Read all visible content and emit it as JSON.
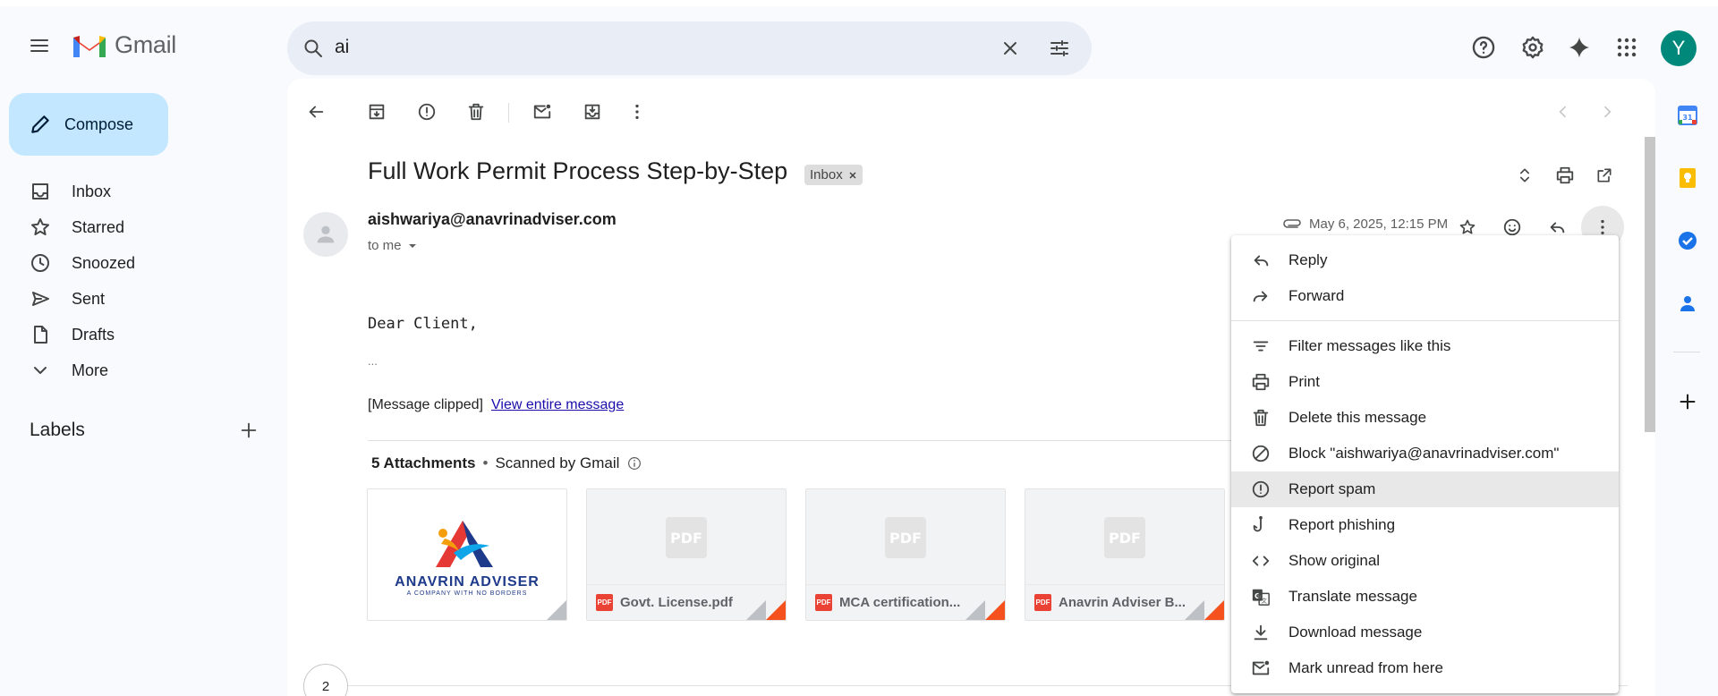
{
  "app": {
    "name": "Gmail",
    "brand_color": "#ea4335"
  },
  "search": {
    "value": "ai"
  },
  "user": {
    "avatar_initial": "Y",
    "avatar_color": "#00897b"
  },
  "sidebar": {
    "compose_label": "Compose",
    "items": [
      {
        "label": "Inbox",
        "icon": "inbox-icon"
      },
      {
        "label": "Starred",
        "icon": "star-icon"
      },
      {
        "label": "Snoozed",
        "icon": "clock-icon"
      },
      {
        "label": "Sent",
        "icon": "send-icon"
      },
      {
        "label": "Drafts",
        "icon": "draft-icon"
      },
      {
        "label": "More",
        "icon": "chevron-down-icon"
      }
    ],
    "labels_title": "Labels"
  },
  "message": {
    "subject": "Full Work Permit Process Step-by-Step",
    "label_chip": "Inbox",
    "sender": "aishwariya@anavrinadviser.com",
    "to": "to me",
    "date": "May 6, 2025, 12:15 PM",
    "greeting": "Dear Client,",
    "ellipsis": "...",
    "clipped_text": "[Message clipped]",
    "view_entire": "View entire message",
    "attachments_title": "5 Attachments",
    "scanned": "Scanned by Gmail",
    "attachments": [
      {
        "name": "",
        "logo_text": "ANAVRIN ADVISER",
        "logo_tagline": "A COMPANY WITH NO BORDERS"
      },
      {
        "name": "Govt. License.pdf"
      },
      {
        "name": "MCA certification..."
      },
      {
        "name": "Anavrin Adviser B..."
      }
    ],
    "pdf_badge": "PDF",
    "thread_count": "2"
  },
  "menu": {
    "items": [
      {
        "label": "Reply",
        "icon": "reply-icon"
      },
      {
        "label": "Forward",
        "icon": "forward-icon"
      },
      {
        "label": "Filter messages like this",
        "icon": "filter-icon"
      },
      {
        "label": "Print",
        "icon": "print-icon"
      },
      {
        "label": "Delete this message",
        "icon": "trash-icon"
      },
      {
        "label": "Block \"aishwariya@anavrinadviser.com\"",
        "icon": "block-icon"
      },
      {
        "label": "Report spam",
        "icon": "report-spam-icon",
        "highlighted": true
      },
      {
        "label": "Report phishing",
        "icon": "phishing-icon"
      },
      {
        "label": "Show original",
        "icon": "code-icon"
      },
      {
        "label": "Translate message",
        "icon": "translate-icon"
      },
      {
        "label": "Download message",
        "icon": "download-icon"
      },
      {
        "label": "Mark unread from here",
        "icon": "mark-unread-icon"
      }
    ]
  }
}
